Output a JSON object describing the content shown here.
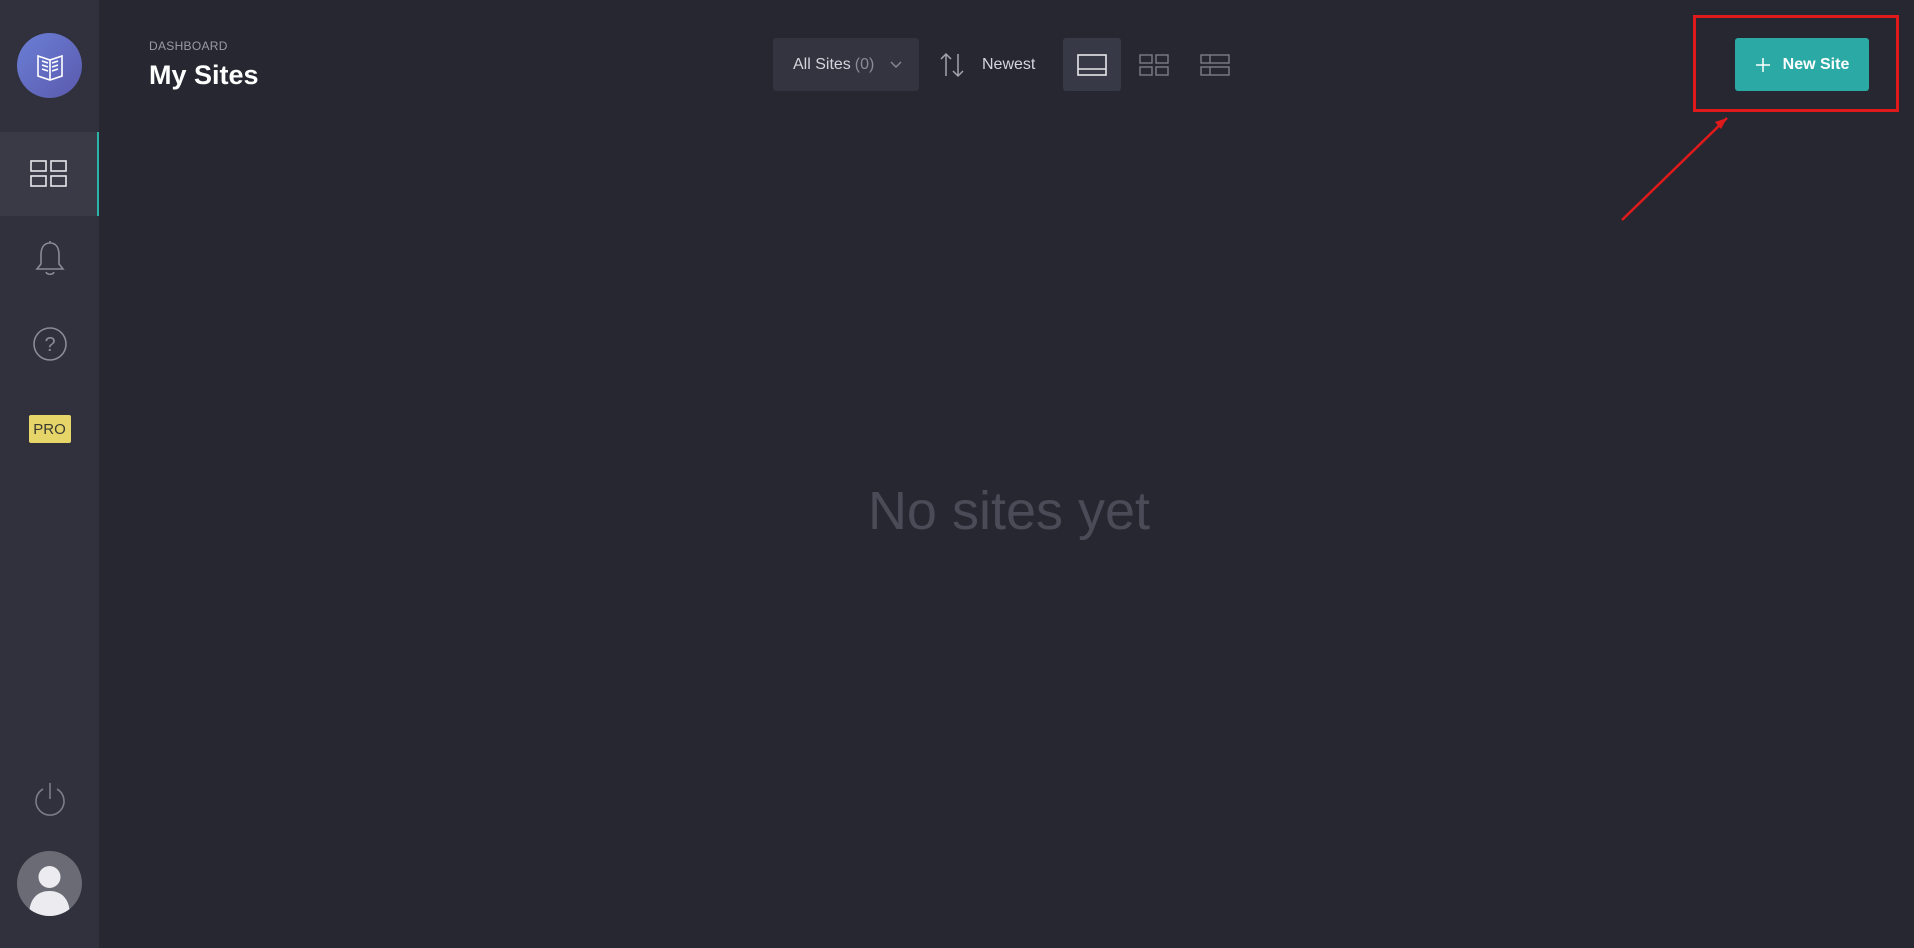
{
  "sidebar": {
    "items": [
      {
        "name": "dashboard",
        "icon": "grid-icon",
        "active": true
      },
      {
        "name": "notifications",
        "icon": "bell-icon"
      },
      {
        "name": "help",
        "icon": "help-icon"
      },
      {
        "name": "pro",
        "icon": "pro-badge",
        "label": "PRO"
      }
    ],
    "power_icon": "power-icon",
    "avatar_icon": "user-avatar-icon"
  },
  "header": {
    "breadcrumb": "DASHBOARD",
    "title": "My Sites"
  },
  "toolbar": {
    "filter": {
      "label": "All Sites",
      "count": "(0)"
    },
    "sort": {
      "label": "Newest"
    },
    "views": [
      "full-view",
      "grid-view",
      "list-view"
    ],
    "new_site_label": "New Site"
  },
  "main": {
    "empty_message": "No sites yet"
  },
  "colors": {
    "background": "#262731",
    "sidebar": "#30313c",
    "accent": "#2ba9a5",
    "pro_badge": "#e6d66a",
    "annotation": "#e01a1a"
  }
}
